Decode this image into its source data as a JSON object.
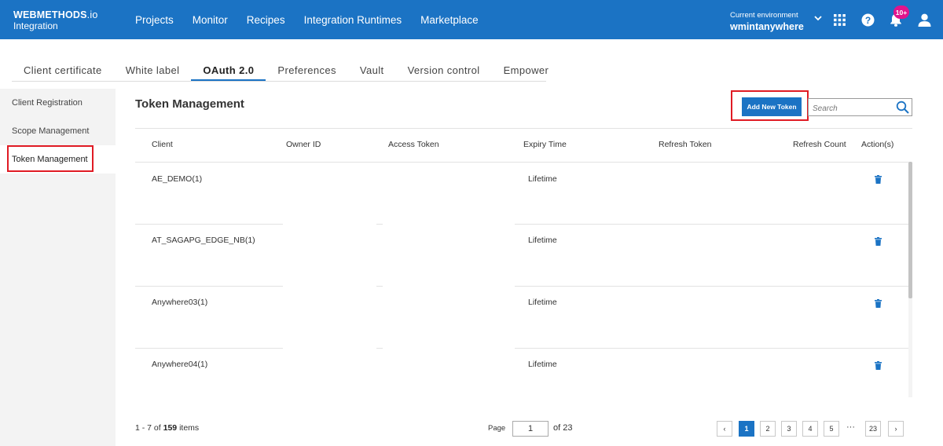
{
  "header": {
    "brand_main": "WEBMETHODS",
    "brand_suffix": ".io",
    "brand_sub": "Integration",
    "nav": [
      "Projects",
      "Monitor",
      "Recipes",
      "Integration Runtimes",
      "Marketplace"
    ],
    "env_label": "Current environment",
    "env_value": "wmintanywhere",
    "notification_badge": "10+",
    "icons": [
      "chevron-down-icon",
      "apps-grid-icon",
      "help-icon",
      "bell-icon",
      "user-icon"
    ],
    "accent_color": "#1b73c4"
  },
  "tabs": [
    "Client certificate",
    "White label",
    "OAuth 2.0",
    "Preferences",
    "Vault",
    "Version control",
    "Empower"
  ],
  "active_tab": "OAuth 2.0",
  "sidebar": {
    "items": [
      "Client Registration",
      "Scope Management",
      "Token Management"
    ],
    "active": "Token Management"
  },
  "main": {
    "title": "Token Management",
    "add_button": "Add New Token",
    "search_placeholder": "Search",
    "columns": [
      "Client",
      "Owner ID",
      "Access Token",
      "Expiry Time",
      "Refresh Token",
      "Refresh Count",
      "Action(s)"
    ],
    "rows": [
      {
        "client": "AE_DEMO(1)",
        "owner_id": "",
        "access_token": "",
        "expiry": "Lifetime",
        "refresh_token": "",
        "refresh_count": ""
      },
      {
        "client": "AT_SAGAPG_EDGE_NB(1)",
        "owner_id": "",
        "access_token": "",
        "expiry": "Lifetime",
        "refresh_token": "",
        "refresh_count": ""
      },
      {
        "client": "Anywhere03(1)",
        "owner_id": "",
        "access_token": "",
        "expiry": "Lifetime",
        "refresh_token": "",
        "refresh_count": ""
      },
      {
        "client": "Anywhere04(1)",
        "owner_id": "",
        "access_token": "",
        "expiry": "Lifetime",
        "refresh_token": "",
        "refresh_count": ""
      }
    ]
  },
  "pagination": {
    "range": "1 - 7 of",
    "total": "159",
    "items_word": "items",
    "page_label": "Page",
    "current_page": "1",
    "of_label": "of 23",
    "pages": [
      "1",
      "2",
      "3",
      "4",
      "5"
    ],
    "ellipsis": "···",
    "last_page": "23",
    "prev": "‹",
    "next": "›"
  }
}
